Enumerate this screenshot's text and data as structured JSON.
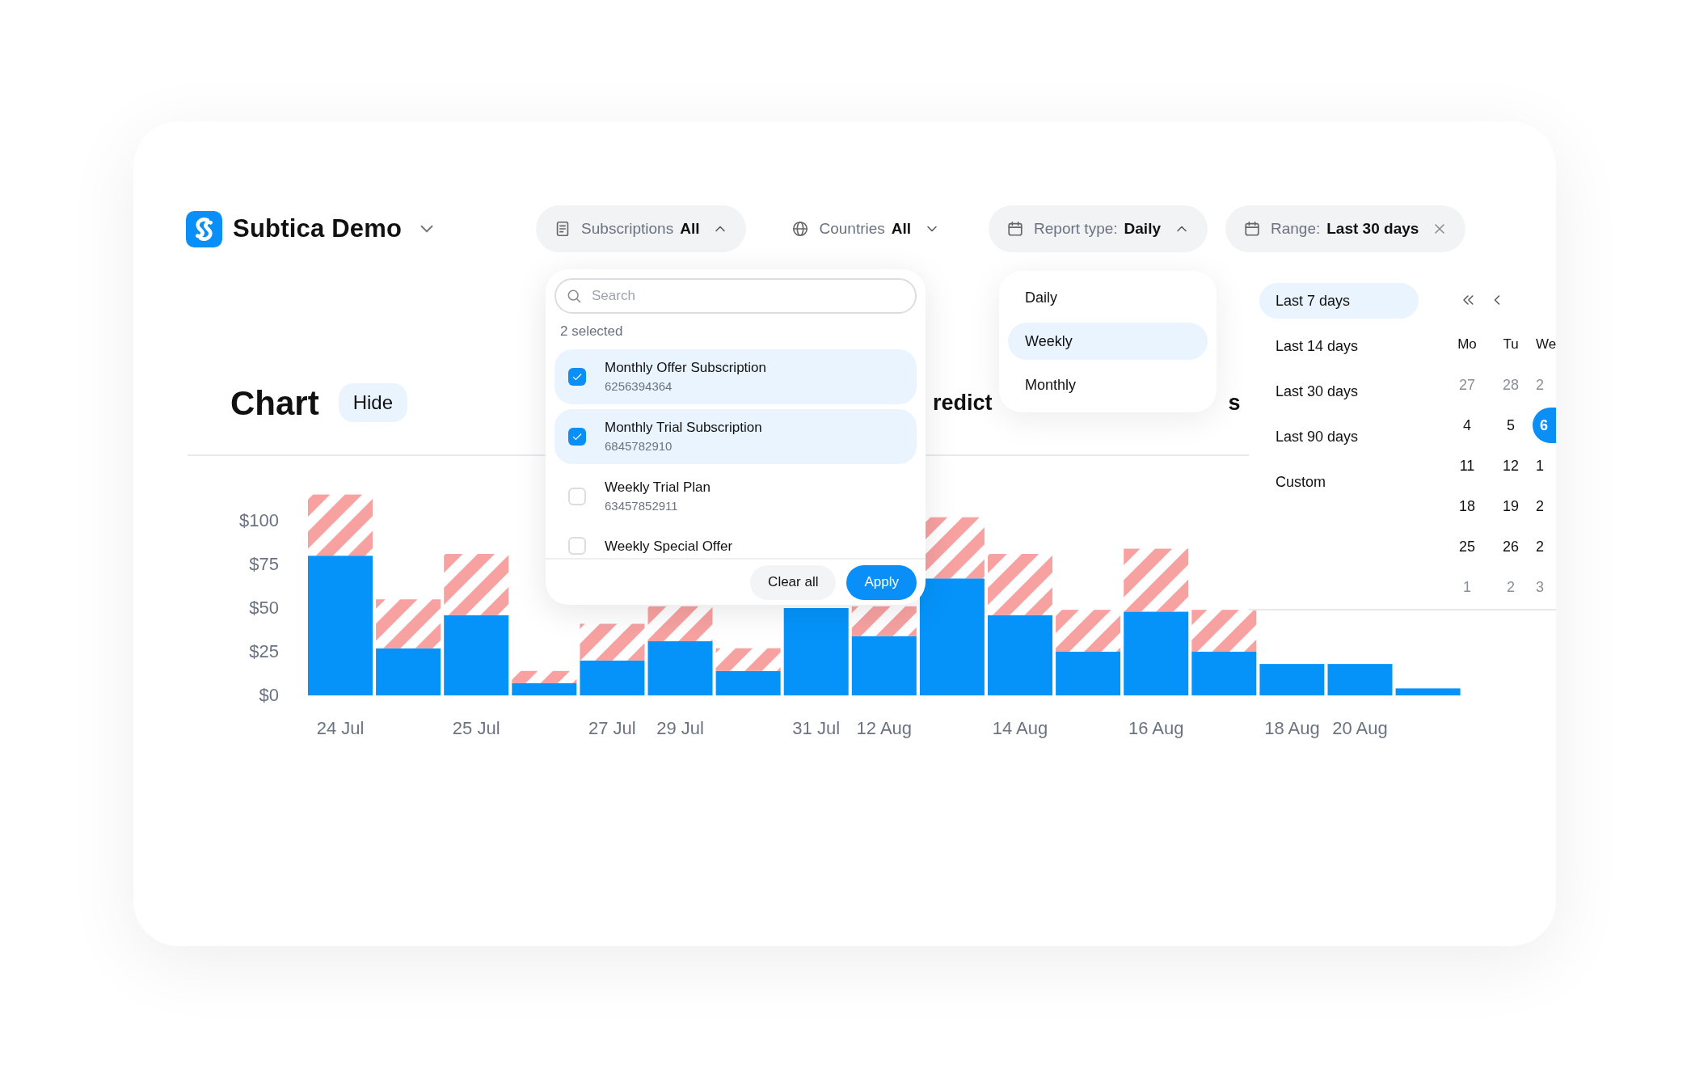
{
  "app": {
    "name": "Subtica Demo"
  },
  "filters": [
    {
      "kind": "list",
      "label": "Subscriptions",
      "value": "All",
      "expanded": true,
      "clearable": false
    },
    {
      "kind": "globe",
      "label": "Countries",
      "value": "All",
      "expanded": false,
      "clearable": false
    },
    {
      "kind": "calendar",
      "label": "Report type:",
      "value": "Daily",
      "expanded": true,
      "clearable": false
    },
    {
      "kind": "calendar",
      "label": "Range:",
      "value": "Last 30 days",
      "expanded": false,
      "clearable": true
    }
  ],
  "chart_section": {
    "title": "Chart",
    "hide_button": "Hide",
    "obscured_labels": [
      "redict",
      "s"
    ],
    "chart_data": {
      "type": "bar",
      "stacked": true,
      "ylim": [
        0,
        115
      ],
      "categories": [
        "24 Jul",
        null,
        "25 Jul",
        null,
        "27 Jul",
        "29 Jul",
        null,
        "31 Jul",
        "12 Aug",
        null,
        "14 Aug",
        null,
        "16 Aug",
        null,
        "18 Aug",
        "20 Aug",
        null
      ],
      "series": [
        {
          "color": "#0593fa",
          "values": [
            80,
            27,
            46,
            7,
            20,
            31,
            14,
            50,
            34,
            67,
            46,
            25,
            48,
            25,
            18,
            18,
            4
          ]
        },
        {
          "color": "#f7a1a1",
          "values": [
            35,
            28,
            35,
            7,
            21,
            20,
            13,
            null,
            17,
            35,
            35,
            24,
            36,
            24,
            null,
            null,
            null
          ]
        }
      ],
      "yticks": [
        {
          "value": 100,
          "label": "$100"
        },
        {
          "value": 75,
          "label": "$75"
        },
        {
          "value": 50,
          "label": "$50"
        },
        {
          "value": 25,
          "label": "$25"
        },
        {
          "value": 0,
          "label": "$0"
        }
      ]
    }
  },
  "subscriptions_dropdown": {
    "search": {
      "placeholder": "Search"
    },
    "selected_count": "2 selected",
    "items": [
      {
        "name": "Monthly Offer Subscription",
        "id": "6256394364",
        "checked": true
      },
      {
        "name": "Monthly Trial Subscription",
        "id": "6845782910",
        "checked": true
      },
      {
        "name": "Weekly Trial Plan",
        "id": "63457852911",
        "checked": false
      },
      {
        "name": "Weekly Special Offer",
        "checked": false
      }
    ],
    "buttons": [
      {
        "kind": "secondary",
        "label": "Clear all"
      },
      {
        "kind": "primary",
        "label": "Apply"
      }
    ]
  },
  "report_type_menu": {
    "items": [
      {
        "label": "Daily",
        "selected": false
      },
      {
        "label": "Weekly",
        "selected": true
      },
      {
        "label": "Monthly",
        "selected": false
      }
    ]
  },
  "range_menu": {
    "presets": [
      {
        "label": "Last 7 days",
        "selected": true
      },
      {
        "label": "Last 14 days",
        "selected": false
      },
      {
        "label": "Last 30 days",
        "selected": false
      },
      {
        "label": "Last 90 days",
        "selected": false
      },
      {
        "label": "Custom",
        "selected": false
      }
    ],
    "calendar": {
      "weekdays": [
        "Mo",
        "Tu",
        "We"
      ],
      "weeks": [
        [
          {
            "day": "27",
            "muted": true,
            "selected": false
          },
          {
            "day": "28",
            "muted": true,
            "selected": false
          },
          {
            "day": "2",
            "muted": true,
            "selected": false
          }
        ],
        [
          {
            "day": "4",
            "muted": false,
            "selected": false
          },
          {
            "day": "5",
            "muted": false,
            "selected": false
          },
          {
            "day": "6",
            "muted": false,
            "selected": true
          }
        ],
        [
          {
            "day": "11",
            "muted": false,
            "selected": false
          },
          {
            "day": "12",
            "muted": false,
            "selected": false
          },
          {
            "day": "1",
            "muted": false,
            "selected": false
          }
        ],
        [
          {
            "day": "18",
            "muted": false,
            "selected": false
          },
          {
            "day": "19",
            "muted": false,
            "selected": false
          },
          {
            "day": "2",
            "muted": false,
            "selected": false
          }
        ],
        [
          {
            "day": "25",
            "muted": false,
            "selected": false
          },
          {
            "day": "26",
            "muted": false,
            "selected": false
          },
          {
            "day": "2",
            "muted": false,
            "selected": false
          }
        ],
        [
          {
            "day": "1",
            "muted": true,
            "selected": false
          },
          {
            "day": "2",
            "muted": true,
            "selected": false
          },
          {
            "day": "3",
            "muted": true,
            "selected": false
          }
        ]
      ]
    }
  }
}
